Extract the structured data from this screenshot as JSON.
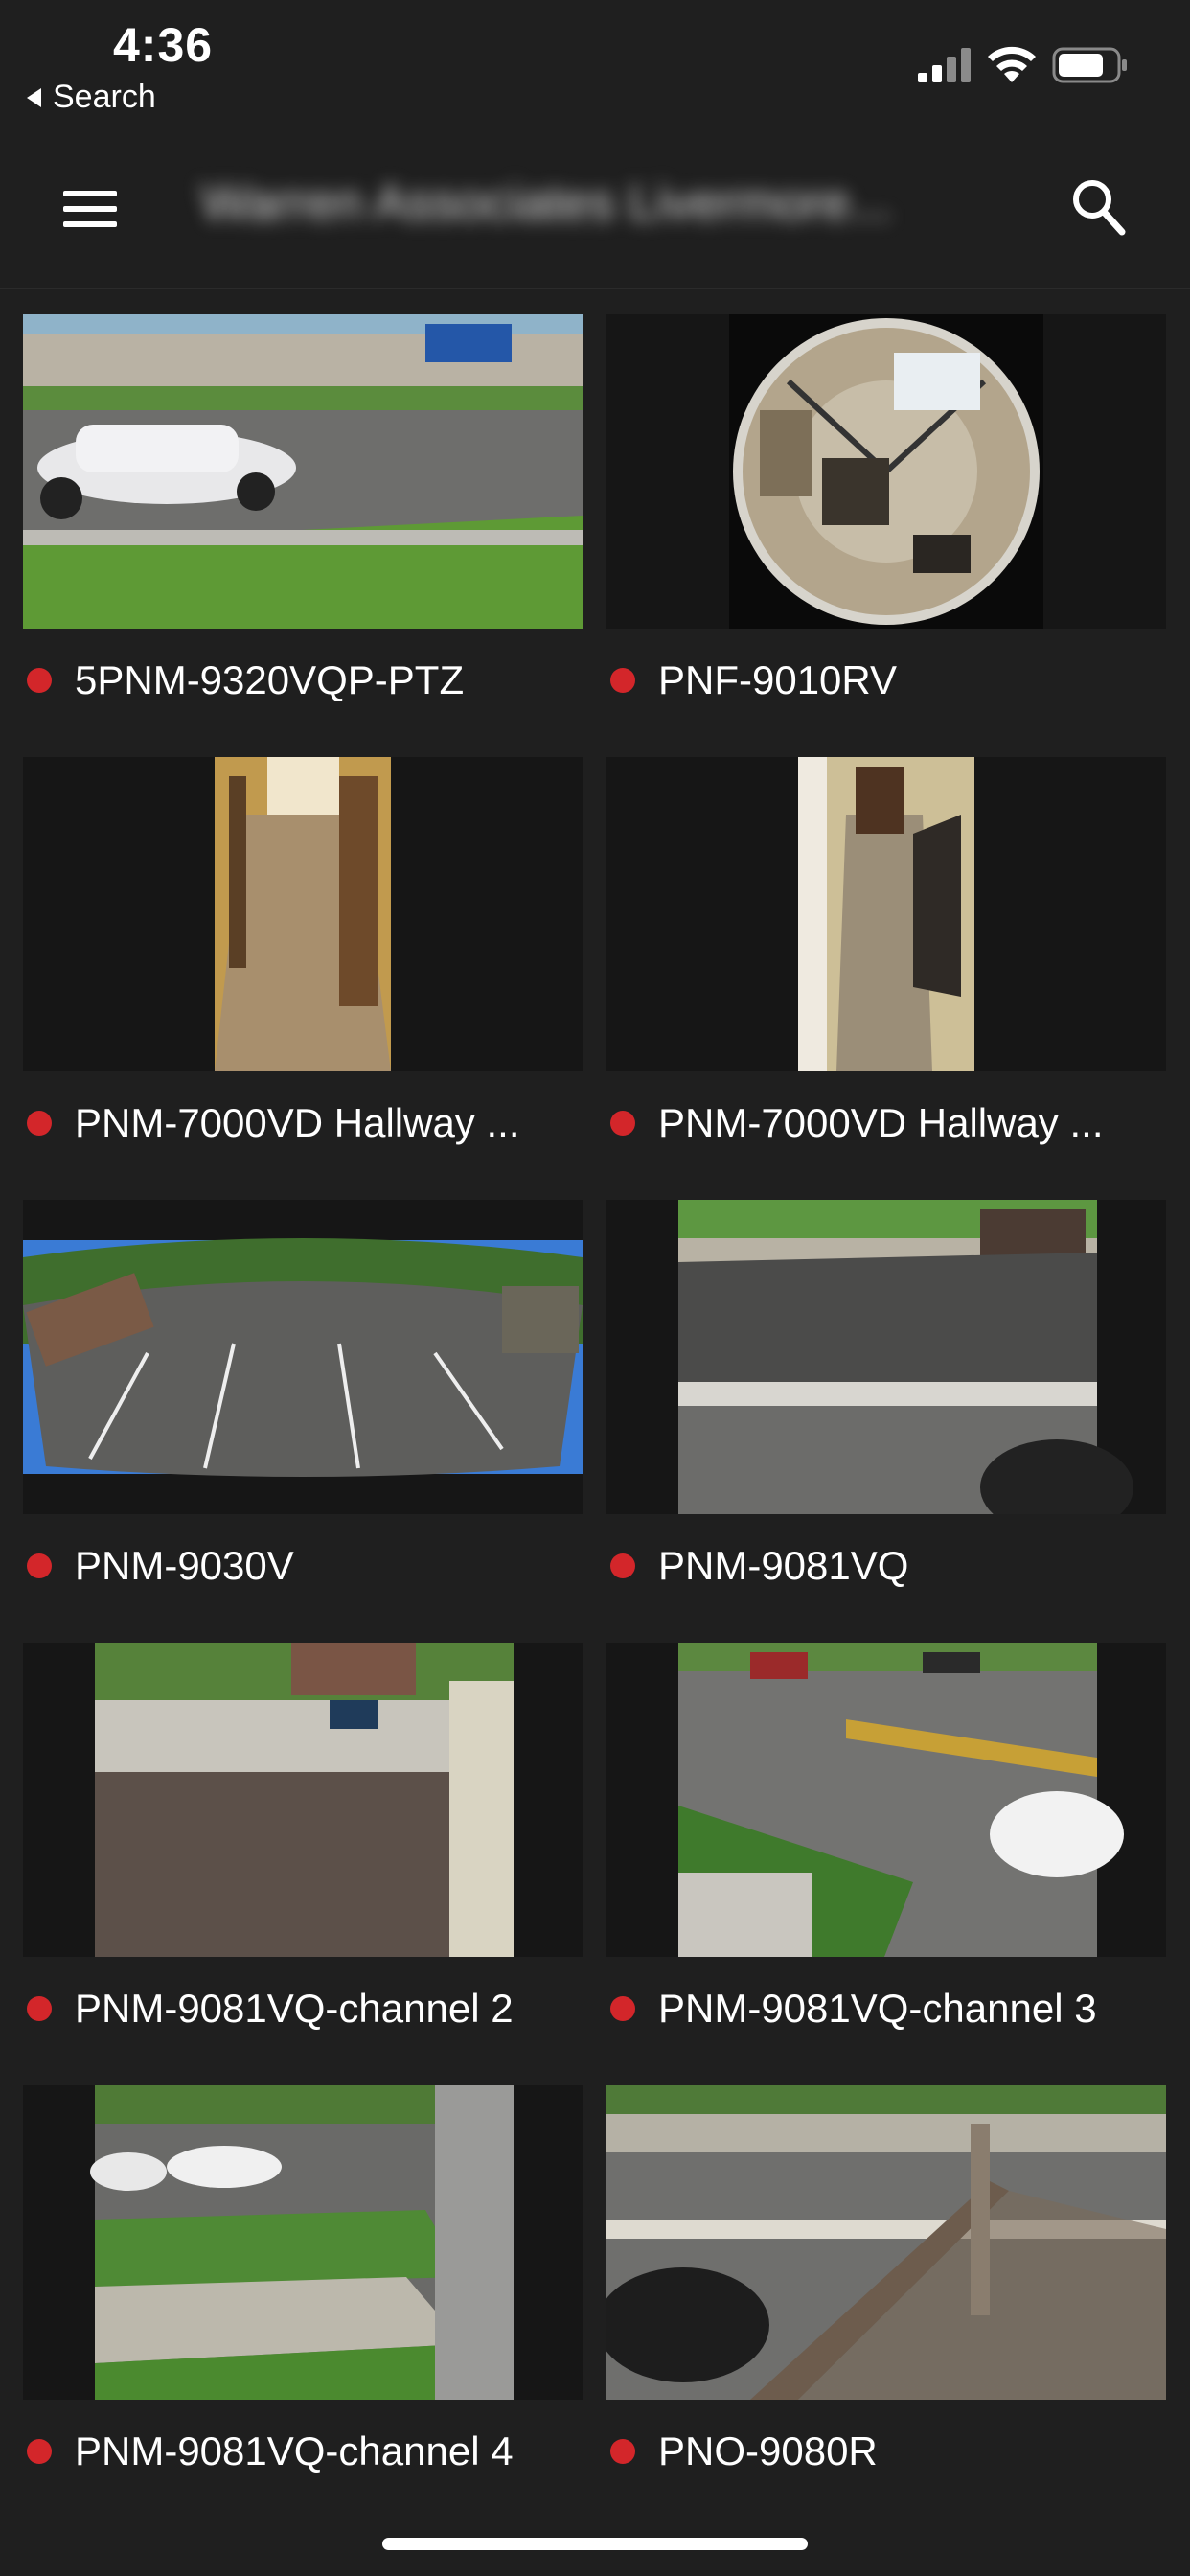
{
  "status": {
    "time": "4:36",
    "back_label": "Search"
  },
  "header": {
    "title": "Warren Associates Livermore..."
  },
  "icons": {
    "menu": "hamburger-menu-icon",
    "search": "search-icon",
    "back": "back-triangle-icon"
  },
  "colors": {
    "background": "#1f1f1f",
    "status_dot": "#d3262a"
  },
  "cameras": [
    {
      "name": "5PNM-9320VQP-PTZ",
      "status": "offline"
    },
    {
      "name": "PNF-9010RV",
      "status": "offline"
    },
    {
      "name": "PNM-7000VD Hallway ...",
      "status": "offline"
    },
    {
      "name": "PNM-7000VD Hallway ...",
      "status": "offline"
    },
    {
      "name": "PNM-9030V",
      "status": "offline"
    },
    {
      "name": "PNM-9081VQ",
      "status": "offline"
    },
    {
      "name": "PNM-9081VQ-channel 2",
      "status": "offline"
    },
    {
      "name": "PNM-9081VQ-channel 3",
      "status": "offline"
    },
    {
      "name": "PNM-9081VQ-channel 4",
      "status": "offline"
    },
    {
      "name": "PNO-9080R",
      "status": "offline"
    }
  ]
}
